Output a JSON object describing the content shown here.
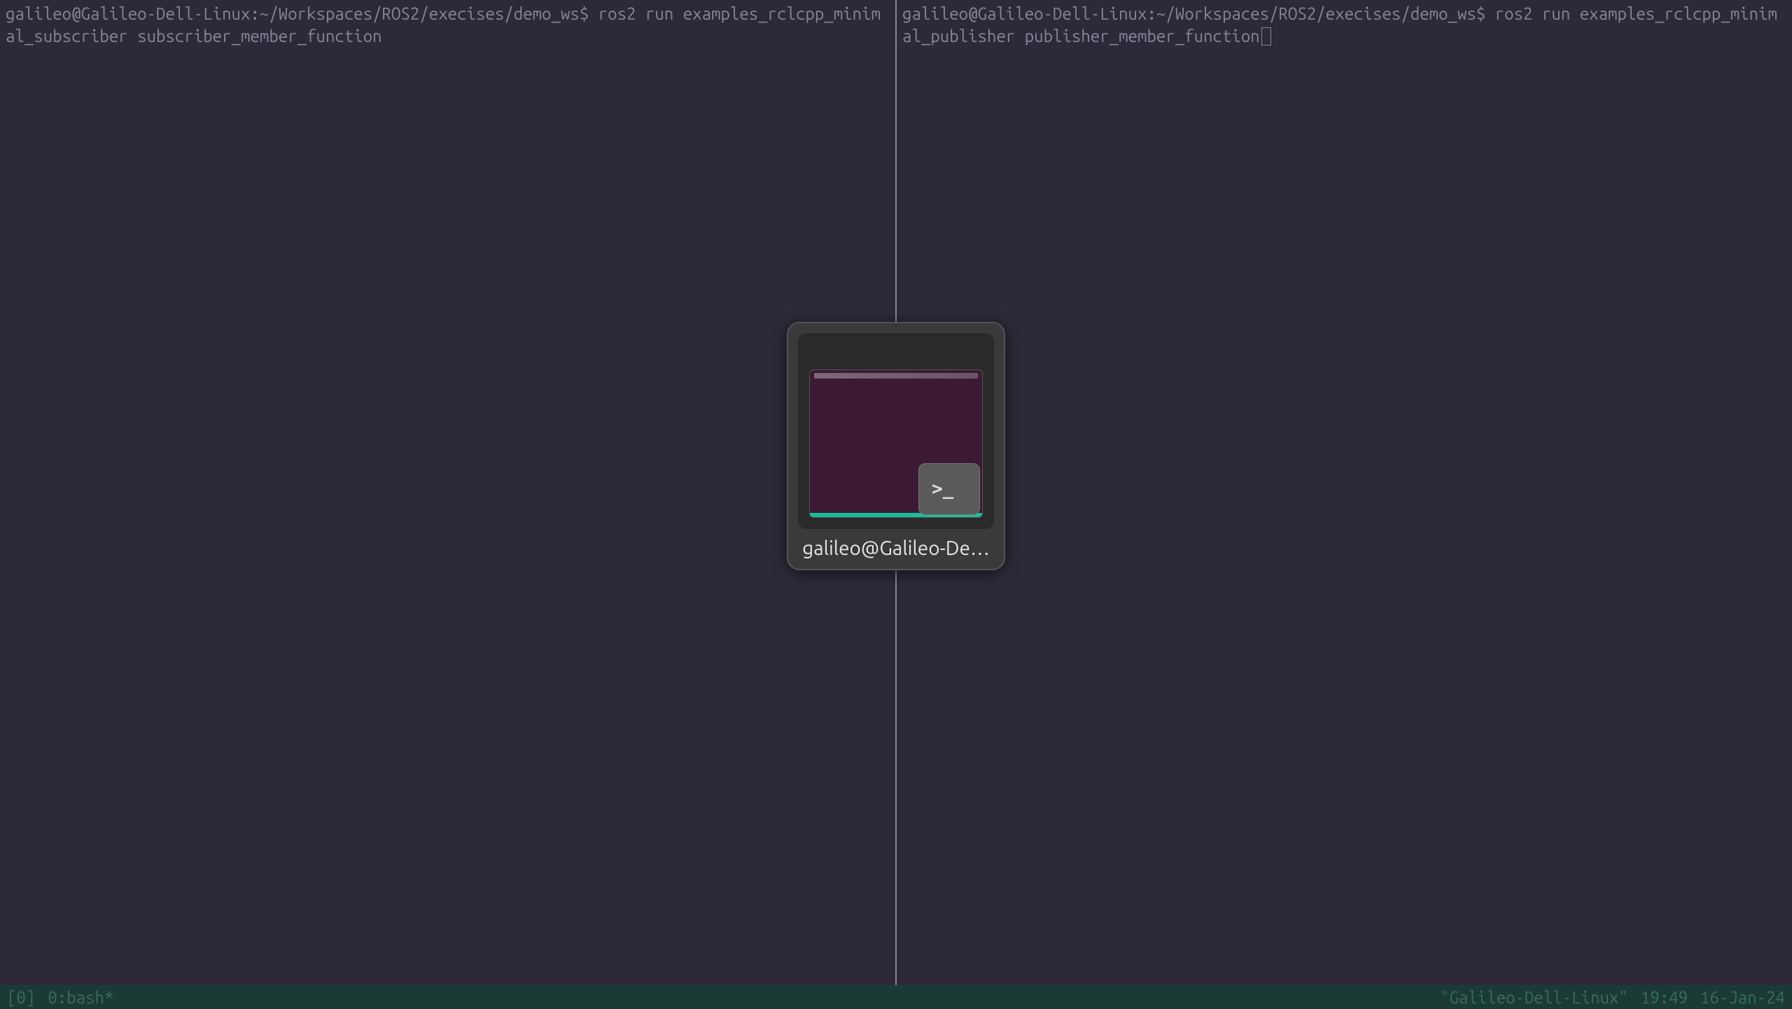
{
  "left_pane": {
    "prompt": "galileo@Galileo-Dell-Linux:~/Workspaces/ROS2/execises/demo_ws$",
    "command": "ros2 run examples_rclcpp_minimal_subscriber subscriber_member_function"
  },
  "right_pane": {
    "prompt": "galileo@Galileo-Dell-Linux:~/Workspaces/ROS2/execises/demo_ws$",
    "command": "ros2 run examples_rclcpp_minimal_publisher publisher_member_function"
  },
  "status_bar": {
    "session": "[0]",
    "window": "0:bash*",
    "hostname": "\"Galileo-Dell-Linux\"",
    "time": "19:49",
    "date": "16-Jan-24"
  },
  "window_switcher": {
    "label": "galileo@Galileo-De…",
    "icon_text": ">_"
  }
}
